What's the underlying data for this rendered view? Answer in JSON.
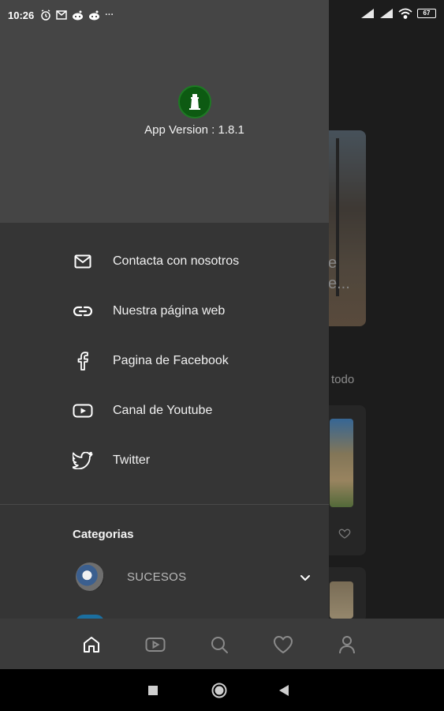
{
  "status_bar": {
    "time": "10:26",
    "battery": "67",
    "left_icons": [
      "alarm-icon",
      "mail-icon",
      "reddit-icon",
      "reddit-icon"
    ],
    "more": "···"
  },
  "drawer": {
    "app_version": "App Version : 1.8.1",
    "menu": [
      {
        "label": "Contacta con nosotros",
        "icon": "mail-icon"
      },
      {
        "label": "Nuestra página web",
        "icon": "link-icon"
      },
      {
        "label": "Pagina de Facebook",
        "icon": "facebook-icon"
      },
      {
        "label": "Canal de Youtube",
        "icon": "youtube-icon"
      },
      {
        "label": "Twitter",
        "icon": "twitter-icon"
      }
    ],
    "categories_title": "Categorias",
    "categories": [
      {
        "label": "SUCESOS"
      }
    ]
  },
  "background": {
    "card_text": "e\ne...",
    "see_all": "todo"
  },
  "bottom_nav": [
    "home-icon",
    "video-icon",
    "search-icon",
    "heart-icon",
    "user-icon"
  ],
  "colors": {
    "drawer_bg": "#353535",
    "drawer_header_bg": "#454545",
    "bottom_nav_bg": "#3b3b3b",
    "logo_green": "#0d5a12"
  }
}
